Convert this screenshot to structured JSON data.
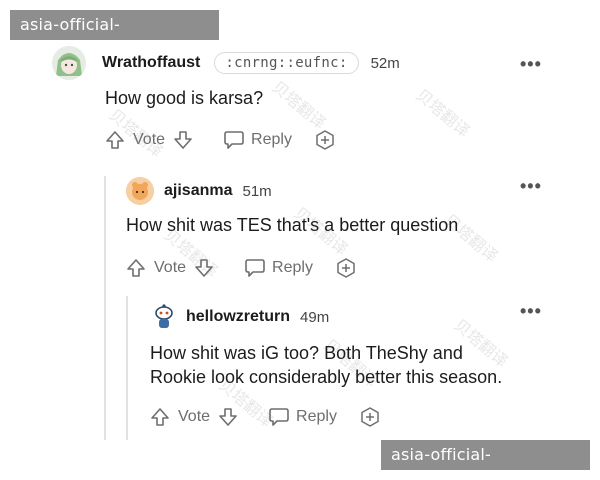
{
  "watermarks": {
    "top": "asia-official-kaiyun.com",
    "bottom": "asia-official-kaiyun.com",
    "faint": "贝塔翻译"
  },
  "actions_labels": {
    "vote": "Vote",
    "reply": "Reply"
  },
  "comments": [
    {
      "username": "Wrathoffaust",
      "flair": ":cnrng::eufnc:",
      "time": "52m",
      "text_lines": [
        "How good is karsa?"
      ],
      "avatar_icon": "anime-girl-avatar"
    },
    {
      "username": "ajisanma",
      "time": "51m",
      "text_lines": [
        "How shit was TES that's a better question"
      ],
      "avatar_icon": "orange-character-avatar"
    },
    {
      "username": "hellowzreturn",
      "time": "49m",
      "text_lines": [
        "How shit was iG too? Both TheShy and",
        "Rookie look considerably better this season."
      ],
      "avatar_icon": "snoo-avatar"
    }
  ],
  "more_icon": "•••",
  "colors": {
    "banner": "#8e8e8e",
    "thread_line": "#e2e2e2",
    "action_gray": "#6e6e6e"
  }
}
